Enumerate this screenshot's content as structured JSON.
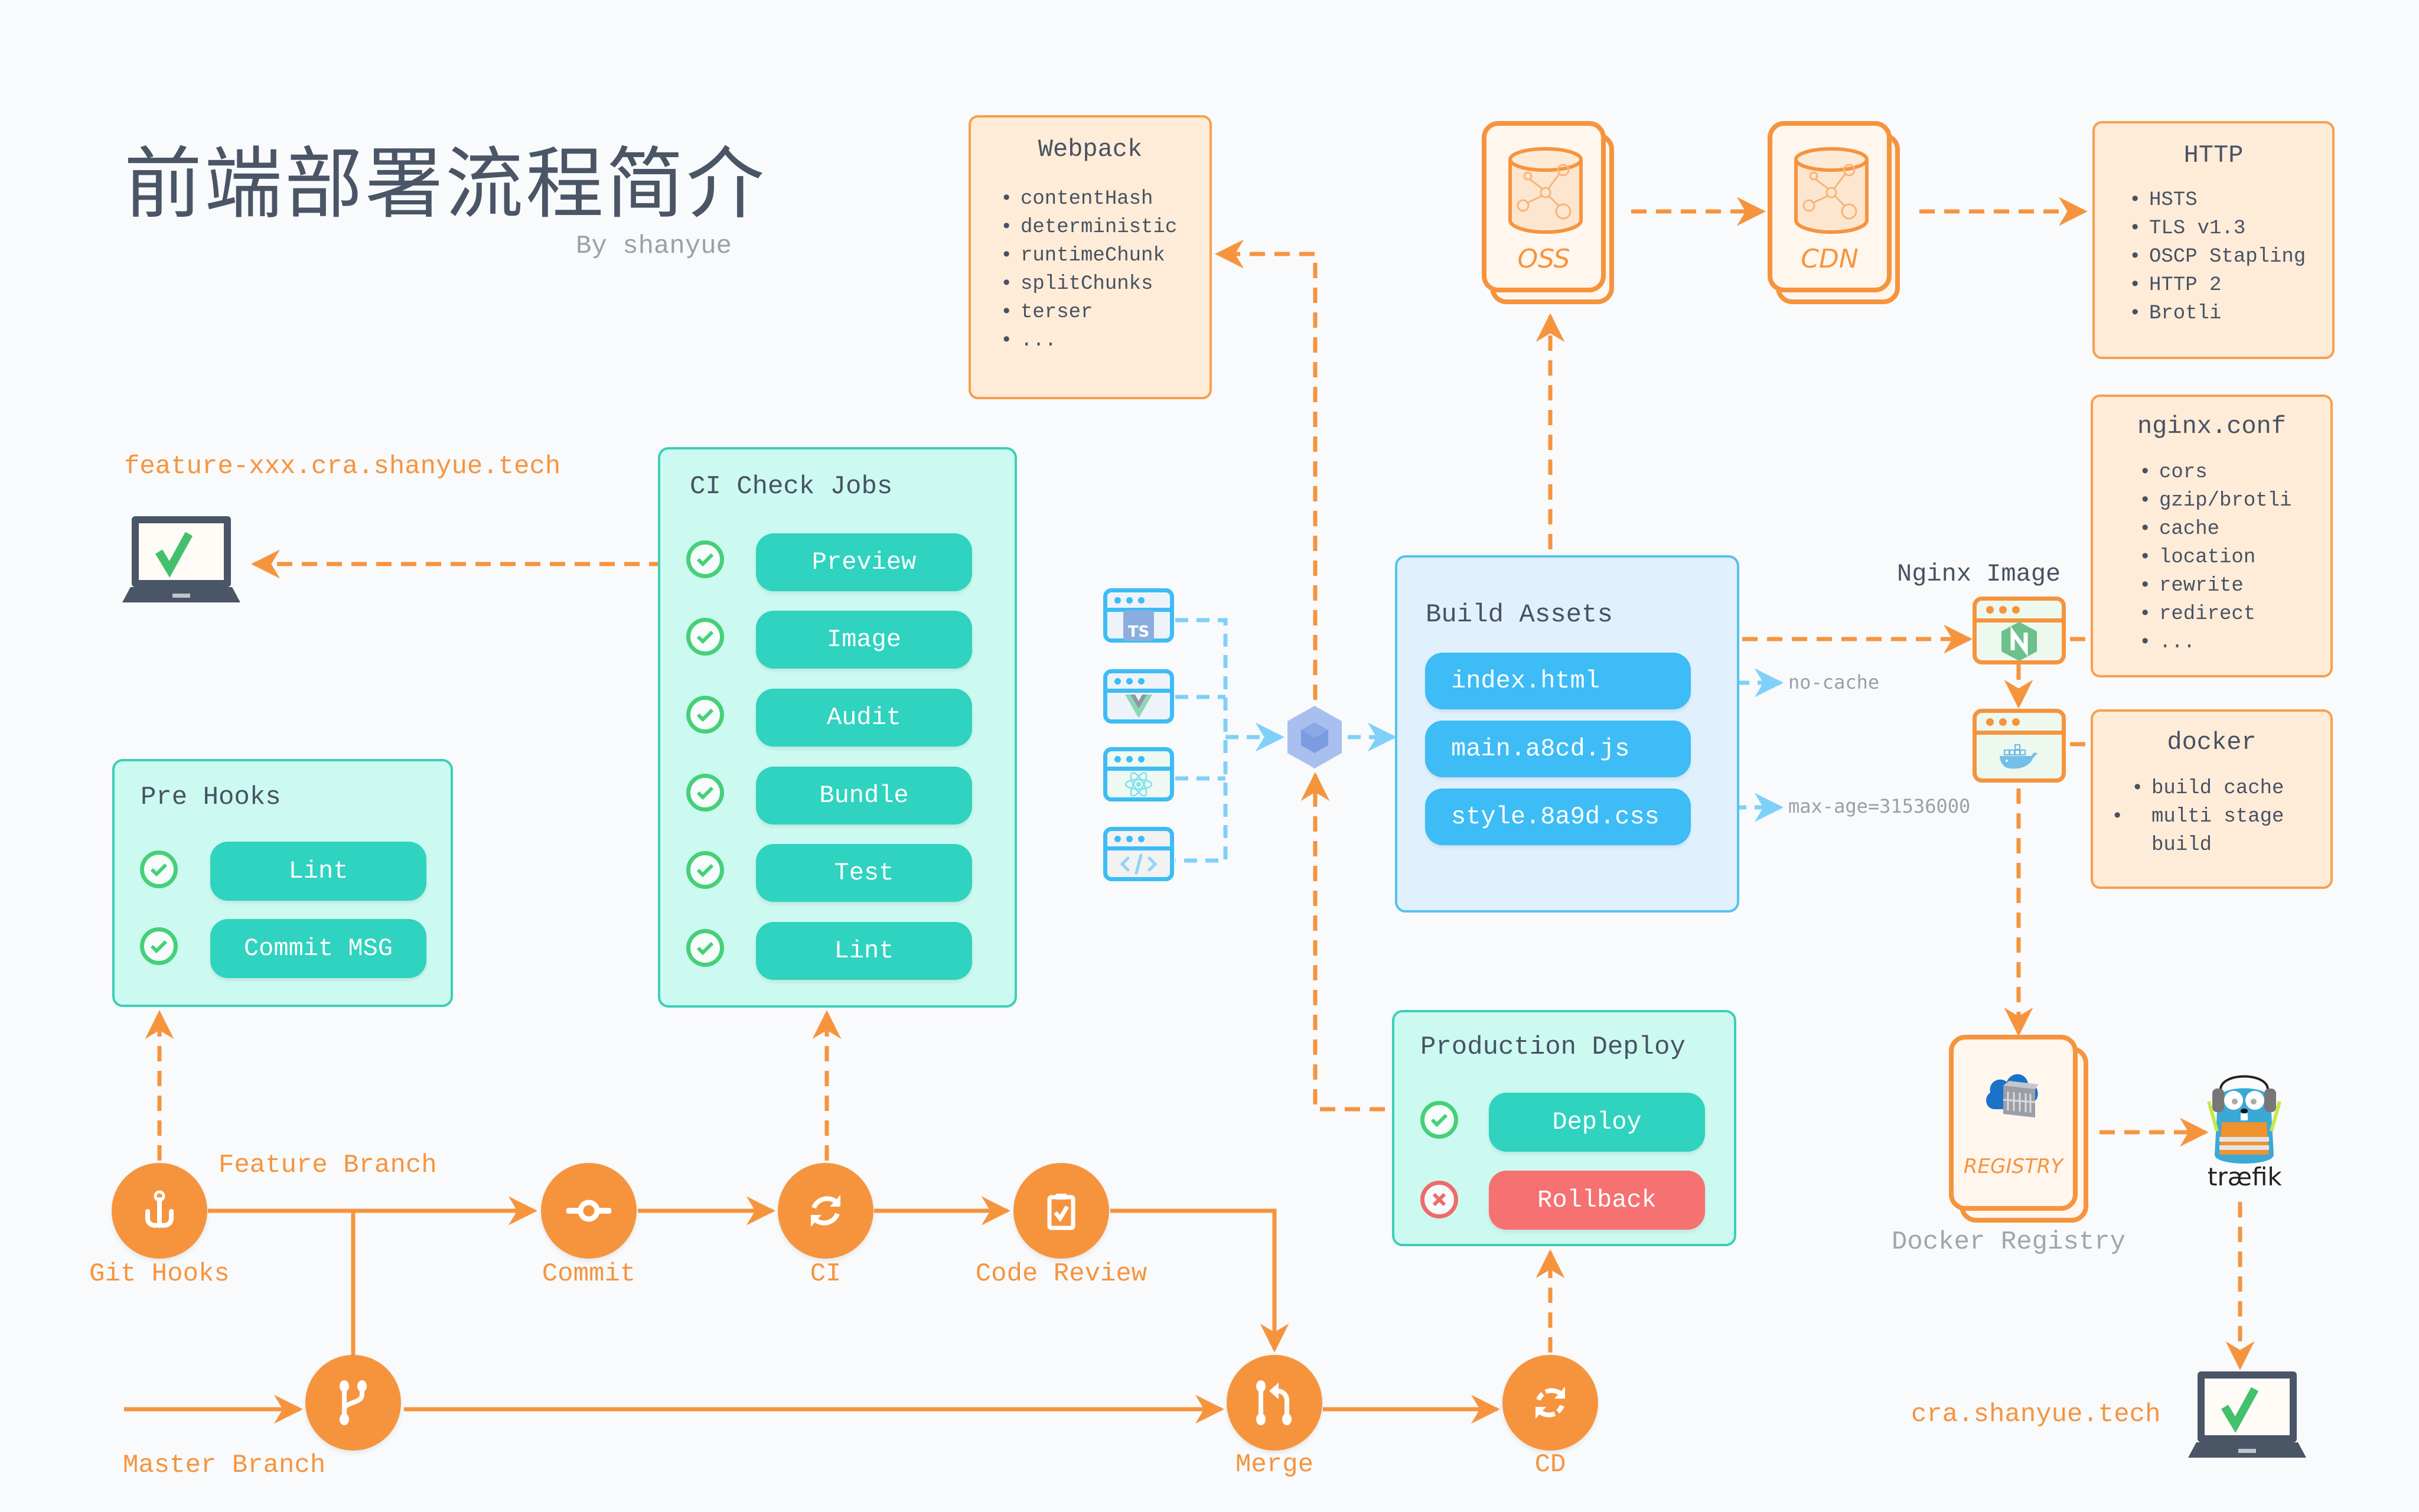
{
  "header": {
    "title": "前端部署流程简介",
    "byline": "By shanyue"
  },
  "colors": {
    "accent_orange": "#f6943e",
    "teal_button": "#2fd3bf",
    "blue_button": "#3dbcf6",
    "red_button": "#f67171",
    "success_green": "#46d079",
    "panel_green_bg": "#ccfaf0",
    "panel_blue_bg": "#e0f1fd",
    "note_bg": "#feecd8",
    "text_dark": "#475263"
  },
  "preview": {
    "url": "feature-xxx.cra.shanyue.tech",
    "icon": "laptop-check-icon"
  },
  "production": {
    "url": "cra.shanyue.tech",
    "icon": "laptop-check-icon"
  },
  "webpack_box": {
    "title": "Webpack",
    "items": [
      "contentHash",
      "deterministic",
      "runtimeChunk",
      "splitChunks",
      "terser",
      "..."
    ]
  },
  "storage": {
    "oss_label": "OSS",
    "cdn_label": "CDN"
  },
  "http_box": {
    "title": "HTTP",
    "items": [
      "HSTS",
      "TLS v1.3",
      "OSCP Stapling",
      "HTTP 2",
      "Brotli"
    ]
  },
  "nginx_conf_box": {
    "title": "nginx.conf",
    "items": [
      "cors",
      "gzip/brotli",
      "cache",
      "location",
      "rewrite",
      "redirect",
      "..."
    ]
  },
  "nginx_image": {
    "label": "Nginx Image",
    "icon": "nginx-icon"
  },
  "docker_box": {
    "title": "docker",
    "items": [
      "build cache",
      "multi stage build"
    ]
  },
  "ci_jobs": {
    "title": "CI Check Jobs",
    "jobs": [
      {
        "label": "Preview",
        "status": "success"
      },
      {
        "label": "Image",
        "status": "success"
      },
      {
        "label": "Audit",
        "status": "success"
      },
      {
        "label": "Bundle",
        "status": "success"
      },
      {
        "label": "Test",
        "status": "success"
      },
      {
        "label": "Lint",
        "status": "success"
      }
    ]
  },
  "pre_hooks": {
    "title": "Pre Hooks",
    "jobs": [
      {
        "label": "Lint",
        "status": "success"
      },
      {
        "label": "Commit MSG",
        "status": "success"
      }
    ]
  },
  "sources": {
    "icons": [
      "typescript-icon",
      "vue-icon",
      "react-icon",
      "code-icon"
    ],
    "bundler_icon": "webpack-icon"
  },
  "build_assets": {
    "title": "Build Assets",
    "files": [
      "index.html",
      "main.a8cd.js",
      "style.8a9d.css"
    ],
    "cache_rules": [
      "no-cache",
      "max-age=31536000"
    ]
  },
  "production_deploy": {
    "title": "Production Deploy",
    "actions": [
      {
        "label": "Deploy",
        "status": "success"
      },
      {
        "label": "Rollback",
        "status": "fail"
      }
    ]
  },
  "registry": {
    "card_label": "REGISTRY",
    "caption": "Docker Registry",
    "proxy_label": "træfik"
  },
  "git_flow": {
    "feature_branch_label": "Feature Branch",
    "master_branch_label": "Master Branch",
    "nodes": [
      {
        "label": "Git Hooks",
        "icon": "hook-icon"
      },
      {
        "label": "Commit",
        "icon": "commit-icon"
      },
      {
        "label": "CI",
        "icon": "sync-icon"
      },
      {
        "label": "Code Review",
        "icon": "clipboard-check-icon"
      },
      {
        "label": "",
        "icon": "branch-icon"
      },
      {
        "label": "Merge",
        "icon": "merge-icon"
      },
      {
        "label": "CD",
        "icon": "sync-icon"
      }
    ]
  }
}
